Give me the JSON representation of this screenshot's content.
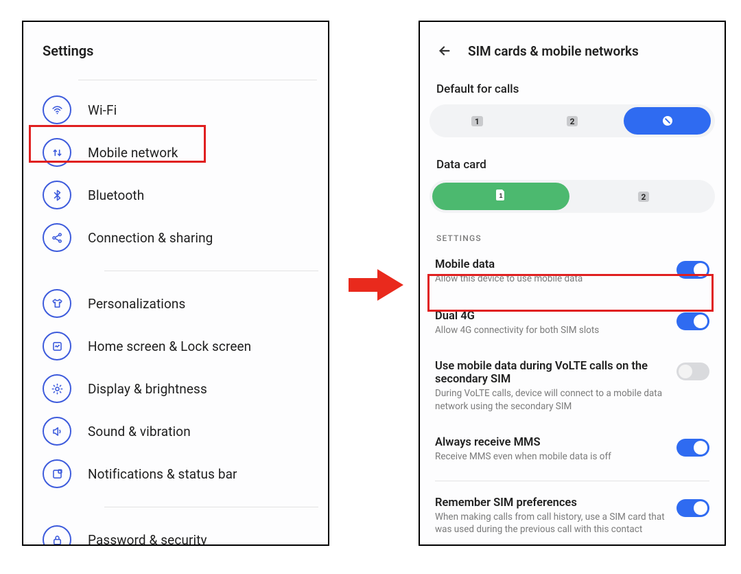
{
  "left": {
    "header": "Settings",
    "items": [
      {
        "id": "wifi",
        "label": "Wi-Fi"
      },
      {
        "id": "mobile-network",
        "label": "Mobile network"
      },
      {
        "id": "bluetooth",
        "label": "Bluetooth"
      },
      {
        "id": "connection",
        "label": "Connection & sharing"
      },
      {
        "id": "personal",
        "label": "Personalizations"
      },
      {
        "id": "home-lock",
        "label": "Home screen & Lock screen"
      },
      {
        "id": "display",
        "label": "Display & brightness"
      },
      {
        "id": "sound",
        "label": "Sound & vibration"
      },
      {
        "id": "notif",
        "label": "Notifications & status bar"
      },
      {
        "id": "password",
        "label": "Password & security"
      }
    ]
  },
  "right": {
    "title": "SIM cards & mobile networks",
    "default_for_calls_label": "Default for calls",
    "data_card_label": "Data card",
    "calls": {
      "slot1": "1",
      "slot2": "2",
      "active": "none"
    },
    "data": {
      "slot1": "1",
      "slot2": "2",
      "active": "1"
    },
    "settings_caption": "SETTINGS",
    "opts": [
      {
        "id": "mobile-data",
        "title": "Mobile data",
        "sub": "Allow this device to use mobile data",
        "on": true
      },
      {
        "id": "dual-4g",
        "title": "Dual 4G",
        "sub": "Allow 4G connectivity for both SIM slots",
        "on": true
      },
      {
        "id": "volte-sec",
        "title": "Use mobile data during VoLTE calls on the secondary SIM",
        "sub": "During VoLTE calls, device will connect to a mobile data network using the secondary SIM",
        "on": false
      },
      {
        "id": "always-mms",
        "title": "Always receive MMS",
        "sub": "Receive MMS even when mobile data is off",
        "on": true
      },
      {
        "id": "remember-sim",
        "title": "Remember SIM preferences",
        "sub": "When making calls from call history, use a SIM card that was used during the previous call with this contact",
        "on": true
      }
    ]
  }
}
